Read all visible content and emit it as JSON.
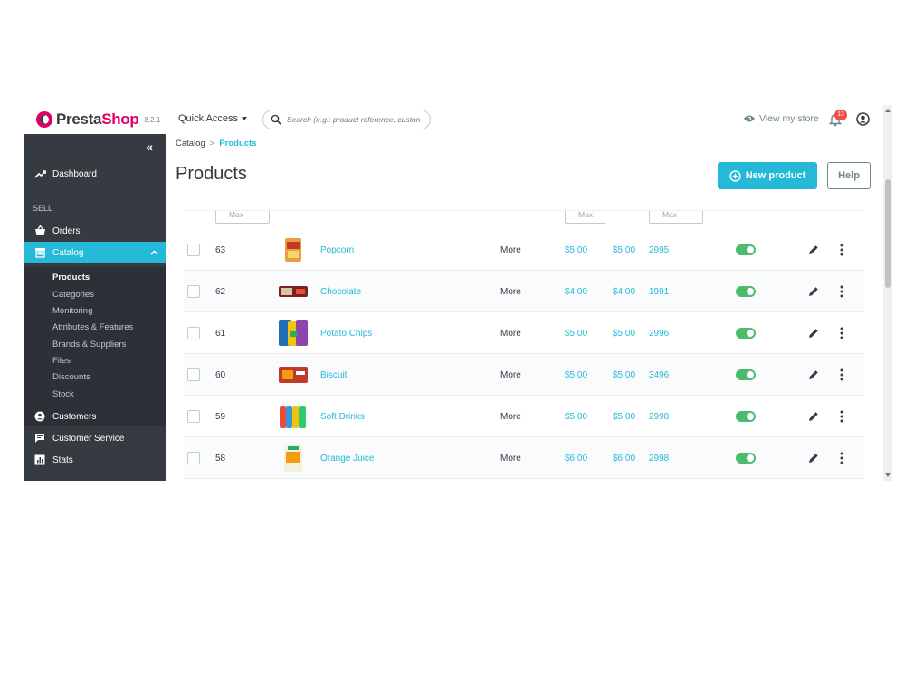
{
  "brand": {
    "name_part1": "Presta",
    "name_part2": "Shop",
    "version": "8.2.1"
  },
  "header": {
    "quick_access": "Quick Access",
    "search_placeholder": "Search (e.g.: product reference, custon",
    "view_store": "View my store",
    "notifications_count": "13"
  },
  "sidebar": {
    "collapse_label": "«",
    "dashboard": "Dashboard",
    "section_sell": "SELL",
    "orders": "Orders",
    "catalog": "Catalog",
    "catalog_sub": [
      "Products",
      "Categories",
      "Monitoring",
      "Attributes & Features",
      "Brands & Suppliers",
      "Files",
      "Discounts",
      "Stock"
    ],
    "customers": "Customers",
    "customer_service": "Customer Service",
    "stats": "Stats"
  },
  "breadcrumb": {
    "parent": "Catalog",
    "separator": ">",
    "current": "Products"
  },
  "page": {
    "title": "Products",
    "new_product": "New product",
    "help": "Help"
  },
  "filters": {
    "id_max": "Max",
    "price_max": "Max",
    "qty_max": "Max"
  },
  "table": {
    "rows": [
      {
        "id": "63",
        "name": "Popcorn",
        "category": "More",
        "price_excl": "$5.00",
        "price_incl": "$5.00",
        "quantity": "2995",
        "status": true,
        "image": "popcorn"
      },
      {
        "id": "62",
        "name": "Chocolate",
        "category": "More",
        "price_excl": "$4.00",
        "price_incl": "$4.00",
        "quantity": "1991",
        "status": true,
        "image": "chocolate"
      },
      {
        "id": "61",
        "name": "Potato Chips",
        "category": "More",
        "price_excl": "$5.00",
        "price_incl": "$5.00",
        "quantity": "2996",
        "status": true,
        "image": "chips"
      },
      {
        "id": "60",
        "name": "Biscuit",
        "category": "More",
        "price_excl": "$5.00",
        "price_incl": "$5.00",
        "quantity": "3496",
        "status": true,
        "image": "biscuit"
      },
      {
        "id": "59",
        "name": "Soft Drinks",
        "category": "More",
        "price_excl": "$5.00",
        "price_incl": "$5.00",
        "quantity": "2998",
        "status": true,
        "image": "drinks"
      },
      {
        "id": "58",
        "name": "Orange Juice",
        "category": "More",
        "price_excl": "$6.00",
        "price_incl": "$6.00",
        "quantity": "2998",
        "status": true,
        "image": "juice"
      }
    ]
  },
  "colors": {
    "accent": "#25b9d7",
    "brand_pink": "#df0067",
    "sidebar_bg": "#363a41",
    "toggle_on": "#4cbb6c"
  },
  "icons": {
    "search": "search-icon",
    "eye": "eye-icon",
    "bell": "bell-icon",
    "account": "account-icon",
    "dashboard": "trending-up-icon",
    "orders": "basket-icon",
    "catalog": "store-icon",
    "customers": "account-circle-icon",
    "customer_service": "chat-icon",
    "stats": "bar-chart-icon",
    "edit": "pencil-icon",
    "more": "more-vert-icon",
    "add": "plus-circle-icon"
  }
}
